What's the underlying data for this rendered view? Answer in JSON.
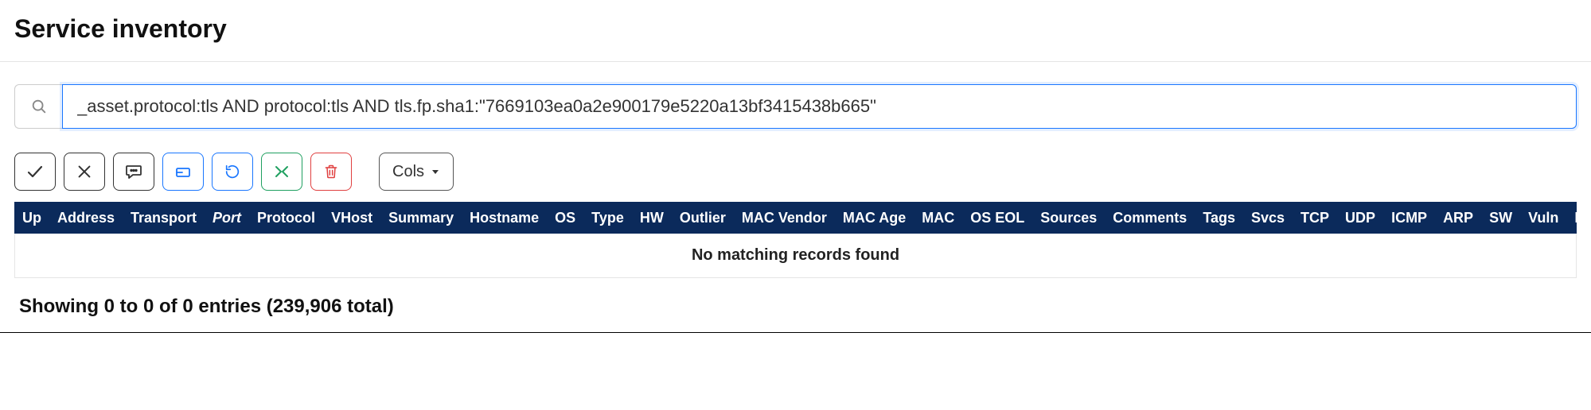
{
  "page_title": "Service inventory",
  "search": {
    "value": "_asset.protocol:tls AND protocol:tls AND tls.fp.sha1:\"7669103ea0a2e900179e5220a13bf3415438b665\""
  },
  "toolbar": {
    "cols_label": "Cols"
  },
  "columns": [
    "Up",
    "Address",
    "Transport",
    "Port",
    "Protocol",
    "VHost",
    "Summary",
    "Hostname",
    "OS",
    "Type",
    "HW",
    "Outlier",
    "MAC Vendor",
    "MAC Age",
    "MAC",
    "OS EOL",
    "Sources",
    "Comments",
    "Tags",
    "Svcs",
    "TCP",
    "UDP",
    "ICMP",
    "ARP",
    "SW",
    "Vuln",
    "R"
  ],
  "sorted_column_index": 3,
  "empty_message": "No matching records found",
  "footer": "Showing 0 to 0 of 0 entries (239,906 total)"
}
